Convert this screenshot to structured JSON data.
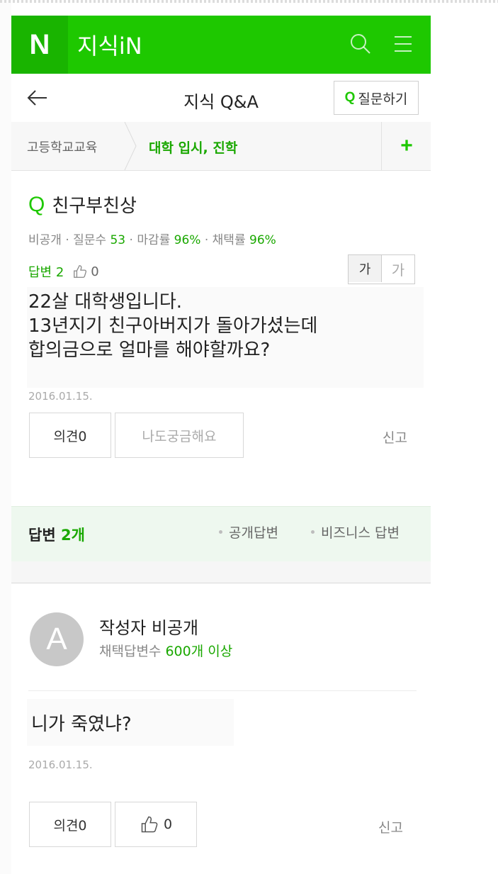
{
  "header": {
    "logo": "N",
    "brand": "지식iN",
    "icons": [
      "search-icon",
      "menu-icon"
    ],
    "accent_color": "#1ec800"
  },
  "subnav": {
    "title": "지식 Q&A",
    "ask_badge": "Q",
    "ask_label": "질문하기"
  },
  "breadcrumb": {
    "parent": "고등학교교육",
    "current": "대학 입시, 진학",
    "add": "+"
  },
  "question": {
    "badge": "Q",
    "title": "친구부친상",
    "stats": {
      "privacy": "비공개",
      "label_questions": "질문수",
      "questions": "53",
      "label_close": "마감률",
      "close_rate": "96%",
      "label_adopt": "채택률",
      "adopt_rate": "96%"
    },
    "answers_label": "답변 2",
    "likes": "0",
    "font_large": "가",
    "font_small": "가",
    "body": [
      "22살 대학생입니다.",
      "13년지기 친구아버지가 돌아가셨는데",
      "합의금으로 얼마를 해야할까요?"
    ],
    "date": "2016.01.15.",
    "opinion_button": "의견0",
    "curious_button": "나도궁금해요",
    "report": "신고"
  },
  "answers_section": {
    "label": "답변",
    "count": "2개",
    "filter_public": "공개답변",
    "filter_business": "비즈니스 답변"
  },
  "answer": {
    "avatar_letter": "A",
    "author": "작성자 비공개",
    "meta_label": "채택답변수",
    "meta_value": "600개 이상",
    "body": "니가 죽였냐?",
    "date": "2016.01.15.",
    "opinion_button": "의견0",
    "likes": "0",
    "report": "신고"
  }
}
